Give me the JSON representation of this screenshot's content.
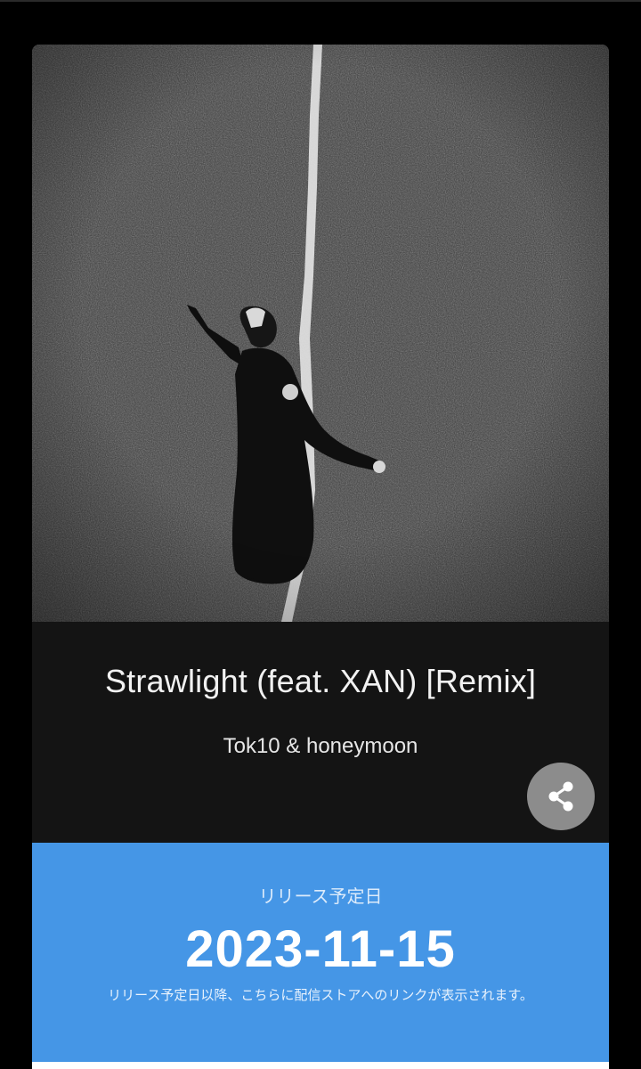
{
  "track": {
    "title": "Strawlight (feat. XAN) [Remix]",
    "artist": "Tok10 & honeymoon"
  },
  "share": {
    "icon": "share-icon"
  },
  "release": {
    "label": "リリース予定日",
    "date": "2023-11-15",
    "note": "リリース予定日以降、こちらに配信ストアへのリンクが表示されます。"
  },
  "colors": {
    "page_background": "#000000",
    "card_background": "#141414",
    "release_banner": "#4596e6",
    "share_button": "#8c8c8c"
  }
}
